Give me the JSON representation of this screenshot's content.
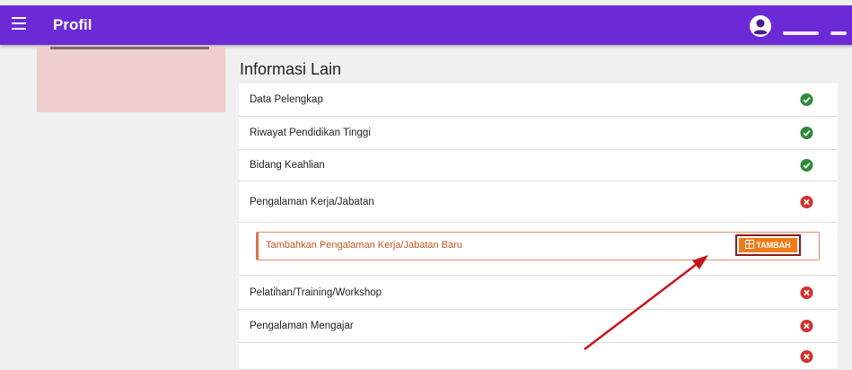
{
  "header": {
    "title": "Profil",
    "menu_icon": "hamburger-menu-icon",
    "user_icon": "account-circle-icon"
  },
  "section": {
    "title": "Informasi Lain"
  },
  "items": [
    {
      "label": "Data Pelengkap",
      "status": "complete"
    },
    {
      "label": "Riwayat Pendidikan Tinggi",
      "status": "complete"
    },
    {
      "label": "Bidang Keahlian",
      "status": "complete"
    },
    {
      "label": "Pengalaman Kerja/Jabatan",
      "status": "incomplete"
    },
    {
      "label": "Pelatihan/Training/Workshop",
      "status": "incomplete"
    },
    {
      "label": "Pengalaman Mengajar",
      "status": "incomplete"
    },
    {
      "label": "",
      "status": "incomplete"
    }
  ],
  "add_card": {
    "label": "Tambahkan Pengalaman Kerja/Jabatan Baru",
    "button_label": "TAMBAH"
  },
  "colors": {
    "topbar": "#6b2ad6",
    "success": "#2e8b3a",
    "error": "#d32f2f",
    "accent": "#f07a18",
    "highlight": "#8b1a1a",
    "arrow": "#c4161c"
  }
}
